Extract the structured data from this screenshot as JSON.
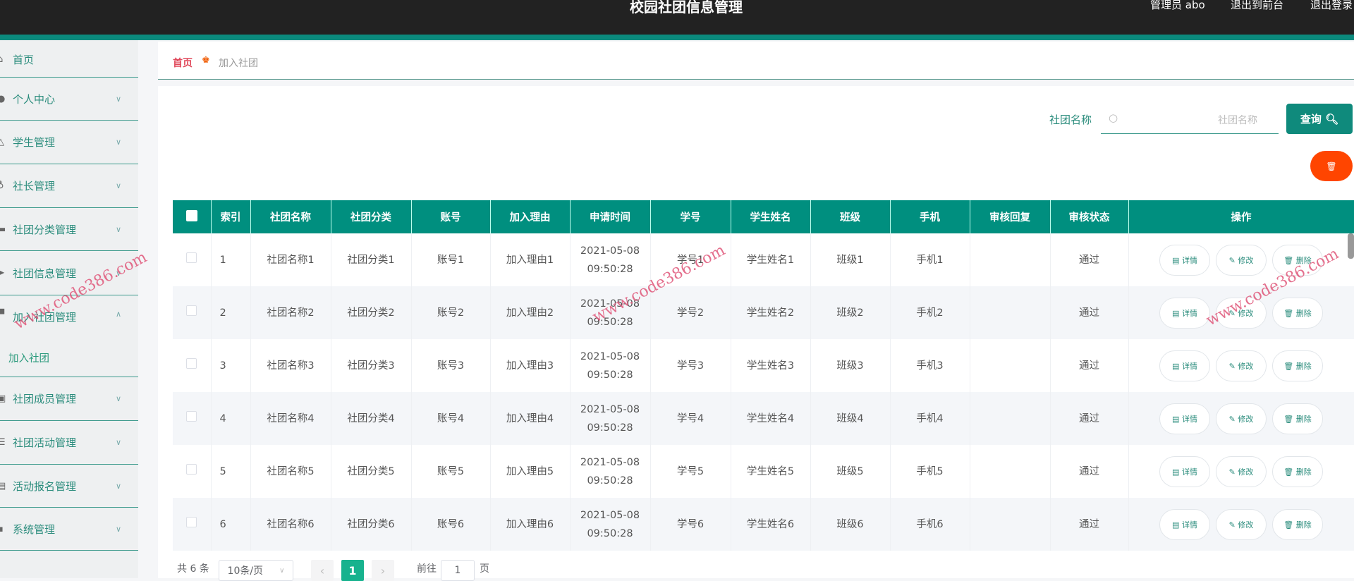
{
  "header": {
    "title": "校园社团信息管理",
    "user": "管理员 abo",
    "to_front": "退出到前台",
    "logout": "退出登录"
  },
  "sidebar": {
    "items": [
      {
        "label": "首页",
        "icon": "home-icon"
      },
      {
        "label": "个人中心",
        "icon": "user-icon"
      },
      {
        "label": "学生管理",
        "icon": "bell-icon"
      },
      {
        "label": "社长管理",
        "icon": "mic-icon"
      },
      {
        "label": "社团分类管理",
        "icon": "briefcase-icon"
      },
      {
        "label": "社团信息管理",
        "icon": "send-icon"
      },
      {
        "label": "加入社团管理",
        "icon": "folder-icon"
      },
      {
        "label": "社团成员管理",
        "icon": "clipboard-icon"
      },
      {
        "label": "社团活动管理",
        "icon": "list-icon"
      },
      {
        "label": "活动报名管理",
        "icon": "form-icon"
      },
      {
        "label": "系统管理",
        "icon": "chat-icon"
      }
    ],
    "sub_item": "加入社团"
  },
  "breadcrumb": {
    "home": "首页",
    "current": "加入社团"
  },
  "search": {
    "label": "社团名称",
    "placeholder": "社团名称",
    "button": "查询"
  },
  "table": {
    "headers": [
      "索引",
      "社团名称",
      "社团分类",
      "账号",
      "加入理由",
      "申请时间",
      "学号",
      "学生姓名",
      "班级",
      "手机",
      "审核回复",
      "审核状态",
      "操作"
    ],
    "rows": [
      [
        "1",
        "社团名称1",
        "社团分类1",
        "账号1",
        "加入理由1",
        "2021-05-08 09:50:28",
        "学号1",
        "学生姓名1",
        "班级1",
        "手机1",
        "",
        "通过"
      ],
      [
        "2",
        "社团名称2",
        "社团分类2",
        "账号2",
        "加入理由2",
        "2021-05-08 09:50:28",
        "学号2",
        "学生姓名2",
        "班级2",
        "手机2",
        "",
        "通过"
      ],
      [
        "3",
        "社团名称3",
        "社团分类3",
        "账号3",
        "加入理由3",
        "2021-05-08 09:50:28",
        "学号3",
        "学生姓名3",
        "班级3",
        "手机3",
        "",
        "通过"
      ],
      [
        "4",
        "社团名称4",
        "社团分类4",
        "账号4",
        "加入理由4",
        "2021-05-08 09:50:28",
        "学号4",
        "学生姓名4",
        "班级4",
        "手机4",
        "",
        "通过"
      ],
      [
        "5",
        "社团名称5",
        "社团分类5",
        "账号5",
        "加入理由5",
        "2021-05-08 09:50:28",
        "学号5",
        "学生姓名5",
        "班级5",
        "手机5",
        "",
        "通过"
      ],
      [
        "6",
        "社团名称6",
        "社团分类6",
        "账号6",
        "加入理由6",
        "2021-05-08 09:50:28",
        "学号6",
        "学生姓名6",
        "班级6",
        "手机6",
        "",
        "通过"
      ]
    ],
    "actions": {
      "detail": "详情",
      "edit": "修改",
      "delete": "删除"
    }
  },
  "pagination": {
    "total": "共 6 条",
    "page_size": "10条/页",
    "current_page": "1",
    "goto_prefix": "前往",
    "goto_value": "1",
    "goto_suffix": "页"
  },
  "watermark": "www.code386.com"
}
